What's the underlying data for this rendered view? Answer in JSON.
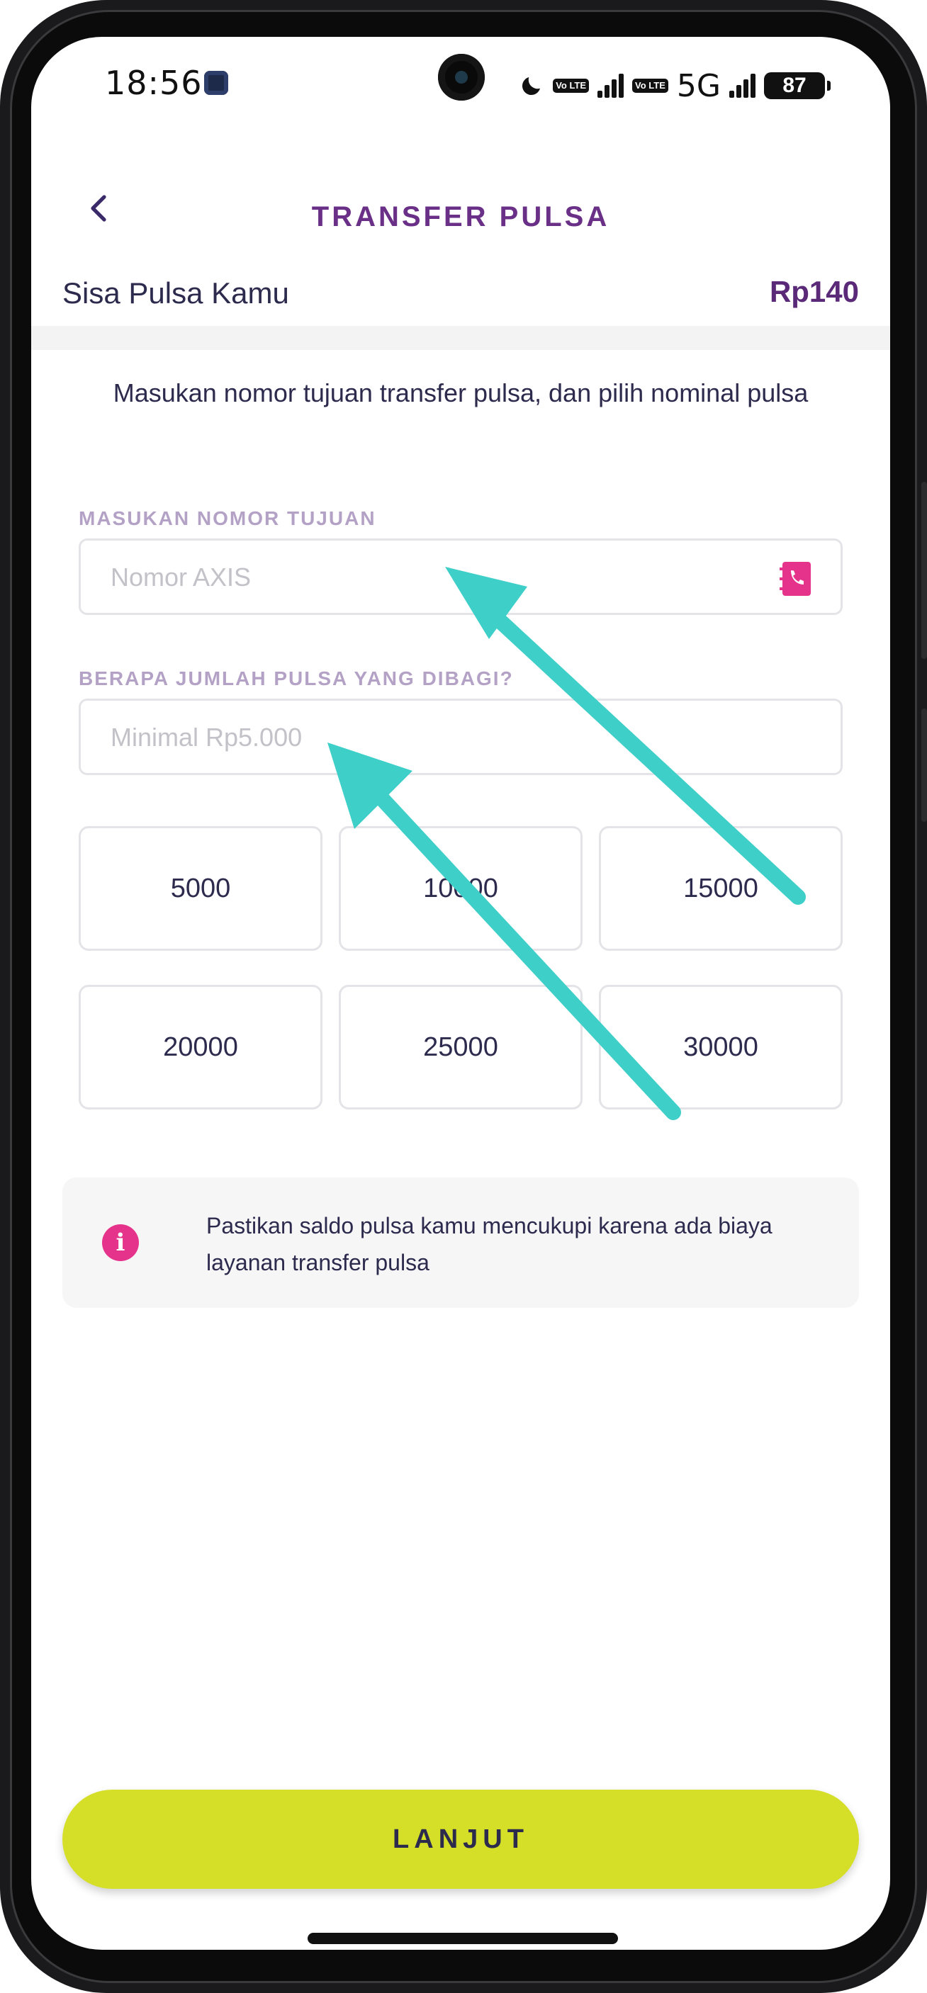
{
  "status_bar": {
    "time": "18:56",
    "volte_1": "Vo LTE",
    "volte_2": "Vo LTE",
    "network": "5G",
    "battery": "87"
  },
  "header": {
    "title": "TRANSFER PULSA"
  },
  "balance": {
    "label": "Sisa Pulsa Kamu",
    "value": "Rp140"
  },
  "instruction": "Masukan nomor tujuan transfer pulsa, dan pilih nominal pulsa",
  "phone_field": {
    "label": "MASUKAN NOMOR TUJUAN",
    "placeholder": "Nomor AXIS",
    "value": ""
  },
  "amount_field": {
    "label": "BERAPA JUMLAH PULSA YANG DIBAGI?",
    "placeholder": "Minimal Rp5.000",
    "value": ""
  },
  "nominals": [
    "5000",
    "10000",
    "15000",
    "20000",
    "25000",
    "30000"
  ],
  "info": {
    "text": "Pastikan saldo pulsa kamu mencukupi karena ada biaya layanan transfer pulsa"
  },
  "cta": {
    "label": "LANJUT"
  },
  "colors": {
    "brand_purple": "#6a2f86",
    "cta_yellow": "#d6df28",
    "info_pink": "#e5338b",
    "annotation_teal": "#3ecfc9"
  }
}
